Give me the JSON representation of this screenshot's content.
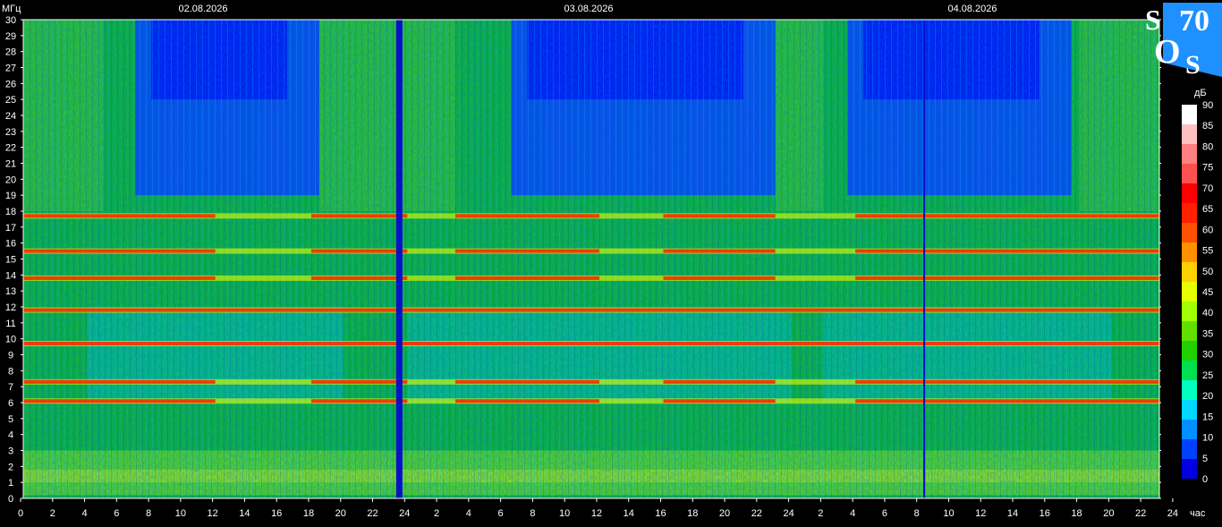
{
  "chart_data": {
    "type": "heatmap",
    "title": "",
    "y_unit": "МГц",
    "x_unit": "час",
    "colorbar_unit": "дБ",
    "dates": [
      "02.08.2026",
      "03.08.2026",
      "04.08.2026"
    ],
    "y_range": [
      0,
      30
    ],
    "y_ticks": [
      "0",
      "1",
      "2",
      "3",
      "4",
      "5",
      "6",
      "7",
      "8",
      "9",
      "10",
      "11",
      "12",
      "13",
      "14",
      "15",
      "16",
      "17",
      "18",
      "19",
      "20",
      "21",
      "22",
      "23",
      "24",
      "25",
      "26",
      "27",
      "28",
      "29",
      "30"
    ],
    "x_ticks": [
      "0",
      "2",
      "4",
      "6",
      "8",
      "10",
      "12",
      "14",
      "16",
      "18",
      "20",
      "22",
      "24",
      "2",
      "4",
      "6",
      "8",
      "10",
      "12",
      "14",
      "16",
      "18",
      "20",
      "22",
      "24",
      "2",
      "4",
      "6",
      "8",
      "10",
      "12",
      "14",
      "16",
      "18",
      "20",
      "22",
      "24"
    ],
    "time_span_hours": [
      0,
      71
    ],
    "colorbar": {
      "ticks": [
        "0",
        "5",
        "10",
        "15",
        "20",
        "25",
        "30",
        "35",
        "40",
        "45",
        "50",
        "55",
        "60",
        "65",
        "70",
        "75",
        "80",
        "85",
        "90"
      ],
      "colors": [
        "#0000e0",
        "#0040ff",
        "#0090ff",
        "#00d8ff",
        "#00ffc0",
        "#00e050",
        "#20d000",
        "#60e000",
        "#a0ff00",
        "#e8ff00",
        "#ffd000",
        "#ff9000",
        "#ff5000",
        "#ff2000",
        "#ff0000",
        "#ff5050",
        "#ff8080",
        "#ffc0c0",
        "#ffffff"
      ]
    },
    "bands_mhz": [
      9.7,
      11.8,
      13.8,
      15.5,
      17.7,
      7.3,
      6.1
    ],
    "gaps_hours": [
      23.5,
      56.3
    ]
  },
  "logo": {
    "top": "S",
    "num": "70",
    "mid": "O",
    "bottom": "S"
  }
}
